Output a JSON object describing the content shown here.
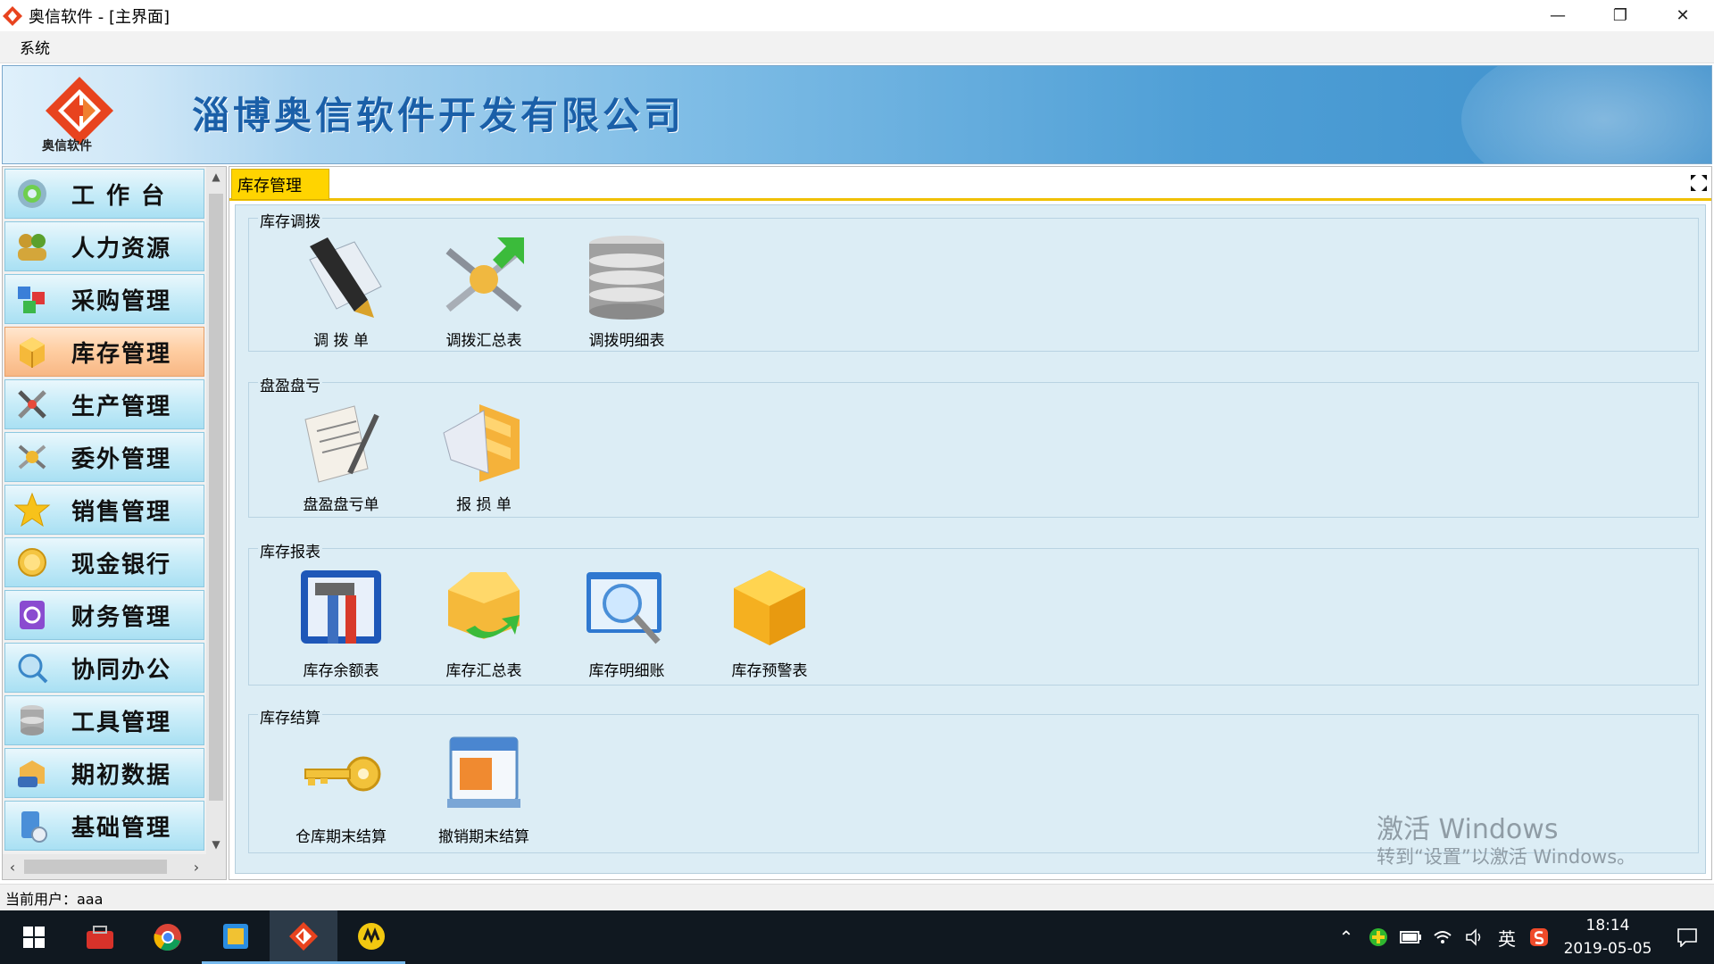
{
  "window": {
    "title": "奥信软件 - [主界面]",
    "minimize_glyph": "—",
    "restore_glyph": "❐",
    "close_glyph": "✕"
  },
  "menu": {
    "items": [
      "系统"
    ]
  },
  "banner": {
    "logo_caption": "奥信软件",
    "company_name": "淄博奥信软件开发有限公司"
  },
  "sidebar": {
    "items": [
      {
        "label": "工 作 台",
        "icon": "gear-icon"
      },
      {
        "label": "人力资源",
        "icon": "people-icon"
      },
      {
        "label": "采购管理",
        "icon": "cubes-icon"
      },
      {
        "label": "库存管理",
        "icon": "box-icon",
        "active": true
      },
      {
        "label": "生产管理",
        "icon": "tools-icon"
      },
      {
        "label": "委外管理",
        "icon": "outsource-icon"
      },
      {
        "label": "销售管理",
        "icon": "star-icon"
      },
      {
        "label": "现金银行",
        "icon": "coin-icon"
      },
      {
        "label": "财务管理",
        "icon": "finance-book-icon"
      },
      {
        "label": "协同办公",
        "icon": "collab-icon"
      },
      {
        "label": "工具管理",
        "icon": "database-icon"
      },
      {
        "label": "期初数据",
        "icon": "initial-data-icon"
      },
      {
        "label": "基础管理",
        "icon": "base-settings-icon"
      }
    ]
  },
  "tabs": {
    "active_label": "库存管理"
  },
  "groups": [
    {
      "title": "库存调拨",
      "items": [
        {
          "label": "调 拨 单",
          "icon": "pen-document-icon"
        },
        {
          "label": "调拨汇总表",
          "icon": "transfer-summary-icon"
        },
        {
          "label": "调拨明细表",
          "icon": "database-stack-icon"
        }
      ]
    },
    {
      "title": "盘盈盘亏",
      "items": [
        {
          "label": "盘盈盘亏单",
          "icon": "notepad-pencil-icon"
        },
        {
          "label": "报 损 单",
          "icon": "damage-report-icon"
        }
      ]
    },
    {
      "title": "库存报表",
      "items": [
        {
          "label": "库存余额表",
          "icon": "toolbox-icon"
        },
        {
          "label": "库存汇总表",
          "icon": "open-box-arrow-icon"
        },
        {
          "label": "库存明细账",
          "icon": "magnifier-window-icon"
        },
        {
          "label": "库存预警表",
          "icon": "golden-cube-icon"
        }
      ]
    },
    {
      "title": "库存结算",
      "items": [
        {
          "label": "仓库期末结算",
          "icon": "key-icon"
        },
        {
          "label": "撤销期末结算",
          "icon": "calendar-undo-icon"
        }
      ]
    }
  ],
  "watermark": {
    "line1": "激活 Windows",
    "line2": "转到“设置”以激活 Windows。"
  },
  "status": {
    "current_user": "当前用户：aaa"
  },
  "taskbar": {
    "tray_lang": "英",
    "time": "18:14",
    "date": "2019-05-05"
  },
  "colors": {
    "banner_text": "#1a5fa8",
    "active_tab": "#ffd400",
    "active_nav": "#ffcfa4",
    "content_bg": "#dcedf5"
  }
}
